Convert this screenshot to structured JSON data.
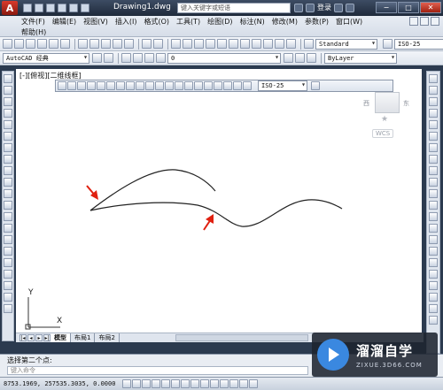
{
  "titlebar": {
    "title": "Drawing1.dwg",
    "search_placeholder": "键入关键字或短语",
    "login_label": "登录",
    "window_controls": [
      "−",
      "□",
      "✕"
    ]
  },
  "menu": {
    "row1": [
      "文件(F)",
      "编辑(E)",
      "视图(V)",
      "插入(I)",
      "格式(O)",
      "工具(T)",
      "绘图(D)",
      "标注(N)",
      "修改(M)",
      "参数(P)",
      "窗口(W)"
    ],
    "row2": [
      "帮助(H)"
    ]
  },
  "toolbar_styles": {
    "text_style": "Standard",
    "dim_style": "ISO-25"
  },
  "toolbar_workspace": {
    "workspace": "AutoCAD 经典",
    "layer": "0",
    "color": "ByLayer"
  },
  "canvas": {
    "viewport_label": "[-][俯视][二维线框]",
    "float_toolbar_combo": "ISO-25",
    "viewcube": {
      "west": "西",
      "east": "东",
      "wcs": "WCS"
    },
    "ucs": {
      "y": "Y",
      "x": "X"
    },
    "arrow_color": "#e02010"
  },
  "layout_tabs": [
    "模型",
    "布局1",
    "布局2"
  ],
  "command": {
    "prompt": "选择第二个点:",
    "input_placeholder": "键入命令"
  },
  "status": {
    "coords": "8753.1969,  257535.3035, 0.0000"
  },
  "watermark": {
    "title": "溜溜自学",
    "subtitle": "ZIXUE.3D66.COM"
  }
}
